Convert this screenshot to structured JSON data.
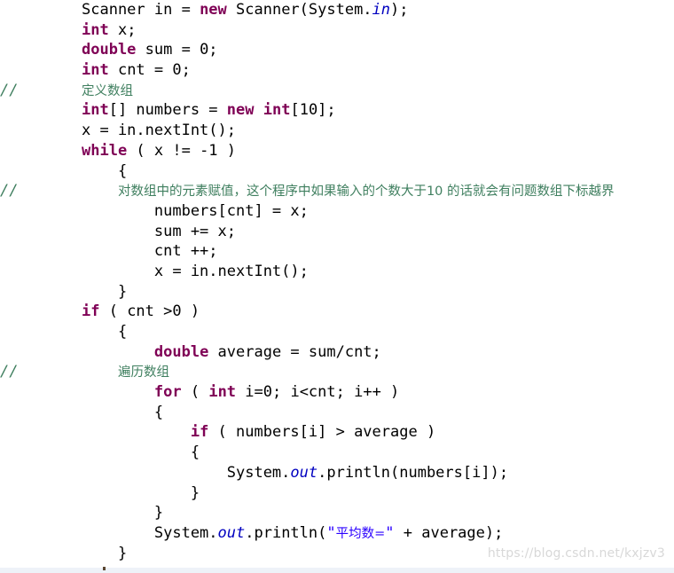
{
  "editor": {
    "language": "java",
    "background_color": "#ffffff",
    "keyword_color": "#7f0055",
    "comment_color": "#3f7f5f",
    "string_color": "#2a00ff",
    "field_color": "#0000c0",
    "text_color": "#000000"
  },
  "watermark": {
    "text": "https://blog.csdn.net/kxjzv3"
  },
  "lines": [
    {
      "gutter": "",
      "tokens": [
        {
          "t": "plain",
          "v": "Scanner in = "
        },
        {
          "t": "kw",
          "v": "new"
        },
        {
          "t": "plain",
          "v": " Scanner(System."
        },
        {
          "t": "field",
          "v": "in"
        },
        {
          "t": "plain",
          "v": ");"
        }
      ]
    },
    {
      "gutter": "",
      "tokens": [
        {
          "t": "kw",
          "v": "int"
        },
        {
          "t": "plain",
          "v": " x;"
        }
      ]
    },
    {
      "gutter": "",
      "tokens": [
        {
          "t": "kw",
          "v": "double"
        },
        {
          "t": "plain",
          "v": " sum = 0;"
        }
      ]
    },
    {
      "gutter": "",
      "tokens": [
        {
          "t": "kw",
          "v": "int"
        },
        {
          "t": "plain",
          "v": " cnt = 0;"
        }
      ]
    },
    {
      "gutter": "//",
      "tokens": [
        {
          "t": "cmt-cjk",
          "v": "定义数组"
        }
      ]
    },
    {
      "gutter": "",
      "tokens": [
        {
          "t": "kw",
          "v": "int"
        },
        {
          "t": "plain",
          "v": "[] numbers = "
        },
        {
          "t": "kw",
          "v": "new"
        },
        {
          "t": "plain",
          "v": " "
        },
        {
          "t": "kw",
          "v": "int"
        },
        {
          "t": "plain",
          "v": "[10];"
        }
      ]
    },
    {
      "gutter": "",
      "tokens": [
        {
          "t": "plain",
          "v": "x = in.nextInt();"
        }
      ]
    },
    {
      "gutter": "",
      "tokens": [
        {
          "t": "kw",
          "v": "while"
        },
        {
          "t": "plain",
          "v": " ( x != -1 )"
        }
      ]
    },
    {
      "gutter": "",
      "tokens": [
        {
          "t": "plain",
          "v": "    {"
        }
      ]
    },
    {
      "gutter": "//",
      "tokens": [
        {
          "t": "plain",
          "v": "    "
        },
        {
          "t": "cmt-cjk",
          "v": "对数组中的元素赋值，这个程序中如果输入的个数大于10 的话就会有问题数组下标越界"
        }
      ]
    },
    {
      "gutter": "",
      "tokens": [
        {
          "t": "plain",
          "v": "        numbers[cnt] = x;"
        }
      ]
    },
    {
      "gutter": "",
      "tokens": [
        {
          "t": "plain",
          "v": "        sum += x;"
        }
      ]
    },
    {
      "gutter": "",
      "tokens": [
        {
          "t": "plain",
          "v": "        cnt ++;"
        }
      ]
    },
    {
      "gutter": "",
      "tokens": [
        {
          "t": "plain",
          "v": "        x = in.nextInt();"
        }
      ]
    },
    {
      "gutter": "",
      "tokens": [
        {
          "t": "plain",
          "v": "    }"
        }
      ]
    },
    {
      "gutter": "",
      "tokens": [
        {
          "t": "kw",
          "v": "if"
        },
        {
          "t": "plain",
          "v": " ( cnt >0 )"
        }
      ]
    },
    {
      "gutter": "",
      "tokens": [
        {
          "t": "plain",
          "v": "    {"
        }
      ]
    },
    {
      "gutter": "",
      "tokens": [
        {
          "t": "plain",
          "v": "        "
        },
        {
          "t": "kw",
          "v": "double"
        },
        {
          "t": "plain",
          "v": " average = sum/cnt;"
        }
      ]
    },
    {
      "gutter": "//",
      "tokens": [
        {
          "t": "plain",
          "v": "    "
        },
        {
          "t": "cmt-cjk",
          "v": "遍历数组"
        }
      ]
    },
    {
      "gutter": "",
      "tokens": [
        {
          "t": "plain",
          "v": "        "
        },
        {
          "t": "kw",
          "v": "for"
        },
        {
          "t": "plain",
          "v": " ( "
        },
        {
          "t": "kw",
          "v": "int"
        },
        {
          "t": "plain",
          "v": " i=0; i<cnt; i++ )"
        }
      ]
    },
    {
      "gutter": "",
      "tokens": [
        {
          "t": "plain",
          "v": "        {"
        }
      ]
    },
    {
      "gutter": "",
      "tokens": [
        {
          "t": "plain",
          "v": "            "
        },
        {
          "t": "kw",
          "v": "if"
        },
        {
          "t": "plain",
          "v": " ( numbers[i] > average )"
        }
      ]
    },
    {
      "gutter": "",
      "tokens": [
        {
          "t": "plain",
          "v": "            {"
        }
      ]
    },
    {
      "gutter": "",
      "tokens": [
        {
          "t": "plain",
          "v": "                System."
        },
        {
          "t": "field",
          "v": "out"
        },
        {
          "t": "plain",
          "v": ".println(numbers[i]);"
        }
      ]
    },
    {
      "gutter": "",
      "tokens": [
        {
          "t": "plain",
          "v": "            }"
        }
      ]
    },
    {
      "gutter": "",
      "tokens": [
        {
          "t": "plain",
          "v": "        }"
        }
      ]
    },
    {
      "gutter": "",
      "tokens": [
        {
          "t": "plain",
          "v": "        System."
        },
        {
          "t": "field",
          "v": "out"
        },
        {
          "t": "plain",
          "v": ".println("
        },
        {
          "t": "str",
          "v": "\""
        },
        {
          "t": "cjk-str",
          "v": "平均数="
        },
        {
          "t": "str",
          "v": "\""
        },
        {
          "t": "plain",
          "v": " + average);"
        }
      ]
    },
    {
      "gutter": "",
      "tokens": [
        {
          "t": "plain",
          "v": "    }"
        }
      ]
    }
  ]
}
